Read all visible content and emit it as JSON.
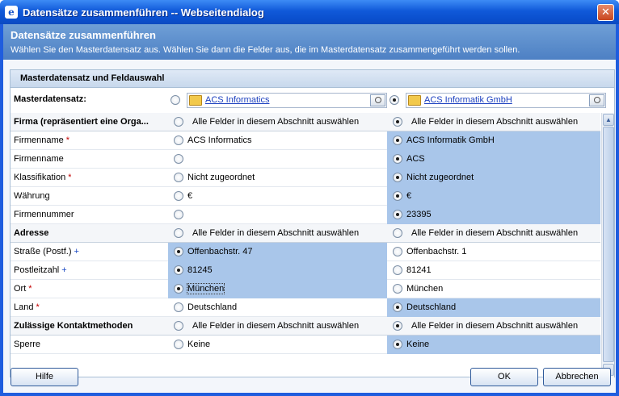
{
  "window": {
    "title": "Datensätze zusammenführen -- Webseitendialog",
    "app_icon": "ie-icon",
    "close_symbol": "✕"
  },
  "header": {
    "title": "Datensätze zusammenführen",
    "description": "Wählen Sie den Masterdatensatz aus. Wählen Sie dann die Felder aus, die im Masterdatensatz zusammengeführt werden sollen."
  },
  "card": {
    "title": "Masterdatensatz und Feldauswahl",
    "master_label": "Masterdatensatz:",
    "master_left": {
      "name": "ACS Informatics",
      "selected": false
    },
    "master_right": {
      "name": "ACS Informatik GmbH",
      "selected": true
    }
  },
  "rows": [
    {
      "type": "section",
      "label": "Firma (repräsentiert eine Orga...",
      "left": "Alle Felder in diesem Abschnitt auswählen",
      "right": "Alle Felder in diesem Abschnitt auswählen",
      "selected": "right"
    },
    {
      "type": "field",
      "label": "Firmenname",
      "mark": "*",
      "mark_kind": "req",
      "left": "ACS Informatics",
      "right": "ACS Informatik GmbH",
      "selected": "right"
    },
    {
      "type": "field",
      "label": "Firmenname",
      "mark": "",
      "mark_kind": "",
      "left": "",
      "right": "ACS",
      "selected": "right"
    },
    {
      "type": "field",
      "label": "Klassifikation",
      "mark": "*",
      "mark_kind": "req",
      "left": "Nicht zugeordnet",
      "right": "Nicht zugeordnet",
      "selected": "right"
    },
    {
      "type": "field",
      "label": "Währung",
      "mark": "",
      "mark_kind": "",
      "left": "€",
      "right": "€",
      "selected": "right"
    },
    {
      "type": "field",
      "label": "Firmennummer",
      "mark": "",
      "mark_kind": "",
      "left": "",
      "right": "23395",
      "selected": "right"
    },
    {
      "type": "section",
      "label": "Adresse",
      "left": "Alle Felder in diesem Abschnitt auswählen",
      "right": "Alle Felder in diesem Abschnitt auswählen",
      "selected": "none"
    },
    {
      "type": "field",
      "label": "Straße (Postf.)",
      "mark": "+",
      "mark_kind": "rec",
      "left": "Offenbachstr. 47",
      "right": "Offenbachstr. 1",
      "selected": "left"
    },
    {
      "type": "field",
      "label": "Postleitzahl",
      "mark": "+",
      "mark_kind": "rec",
      "left": "81245",
      "right": "81241",
      "selected": "left"
    },
    {
      "type": "field",
      "label": "Ort",
      "mark": "*",
      "mark_kind": "req",
      "left": "München",
      "right": "München",
      "selected": "left",
      "focused": true
    },
    {
      "type": "field",
      "label": "Land",
      "mark": "*",
      "mark_kind": "req",
      "left": "Deutschland",
      "right": "Deutschland",
      "selected": "right"
    },
    {
      "type": "section",
      "label": "Zulässige Kontaktmethoden",
      "left": "Alle Felder in diesem Abschnitt auswählen",
      "right": "Alle Felder in diesem Abschnitt auswählen",
      "selected": "right"
    },
    {
      "type": "field",
      "label": "Sperre",
      "mark": "",
      "mark_kind": "",
      "left": "Keine",
      "right": "Keine",
      "selected": "right"
    }
  ],
  "scrollbar": {
    "up": "▲",
    "down": "▼"
  },
  "footer": {
    "help_label": "Hilfe",
    "ok_label": "OK",
    "cancel_label": "Abbrechen"
  },
  "colors": {
    "title_bar": "#0a4fcd",
    "header_band": "#5d8fcd",
    "selected_cell": "#a9c6ea",
    "required_mark": "#c30000",
    "recommended_mark": "#1a49c3"
  }
}
